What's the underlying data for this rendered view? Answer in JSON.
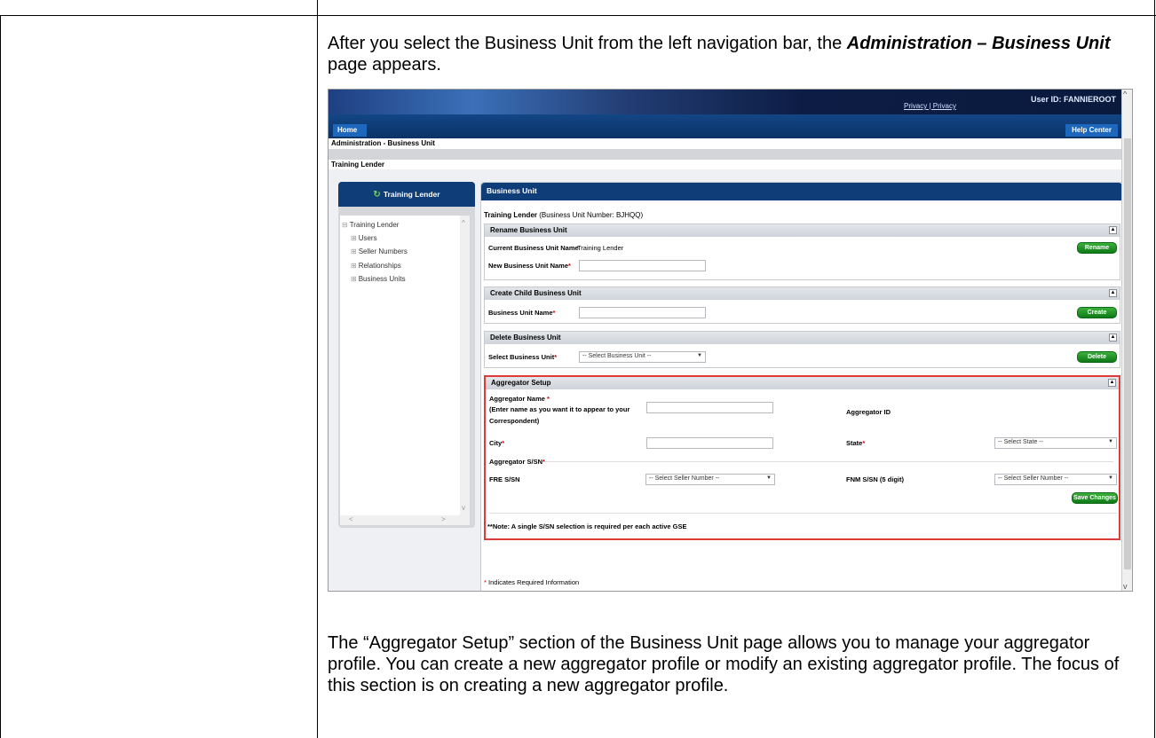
{
  "doc": {
    "intro_pre": "After you select the Business Unit from the left navigation bar, the ",
    "intro_bold": "Administration – Business Unit",
    "intro_post": " page appears.",
    "bottom": "The “Aggregator Setup” section of the Business Unit page allows you to manage your aggregator profile.  You can create a new aggregator profile or modify an existing aggregator profile.  The focus of this section is on creating a new aggregator profile."
  },
  "app": {
    "privacy": "Privacy  |  Privacy",
    "user_id": "User ID: FANNIEROOT",
    "home": "Home",
    "help_center": "Help Center",
    "breadcrumb": "Administration - Business Unit",
    "lender_title": "Training Lender"
  },
  "sidebar": {
    "title": "Training Lender",
    "root": "Training Lender",
    "items": [
      "Users",
      "Seller Numbers",
      "Relationships",
      "Business Units"
    ]
  },
  "business_unit": {
    "title": "Business Unit",
    "lender_name": "Training Lender",
    "lender_number": "(Business Unit Number: BJHQQ)",
    "rename": {
      "title": "Rename Business Unit",
      "current_label": "Current Business Unit Name",
      "current_value": "Training Lender",
      "new_label": "New Business Unit Name",
      "button": "Rename"
    },
    "create": {
      "title": "Create Child Business Unit",
      "name_label": "Business Unit Name",
      "button": "Create"
    },
    "delete": {
      "title": "Delete Business Unit",
      "select_label": "Select Business Unit",
      "select_value": "-- Select Business Unit --",
      "button": "Delete"
    },
    "aggregator": {
      "title": "Aggregator Setup",
      "name_label": "Aggregator Name",
      "name_hint_1": "(Enter name as you want it to appear to your",
      "name_hint_2": "Correspondent)",
      "id_label": "Aggregator ID",
      "city_label": "City",
      "state_label": "State",
      "state_value": "-- Select State --",
      "ssn_label": "Aggregator S/SN",
      "fre_label": "FRE S/SN",
      "fre_value": "-- Select Seller Number --",
      "fnm_label": "FNM S/SN (5 digit)",
      "fnm_value": "-- Select Seller Number --",
      "save_button": "Save Changes",
      "note": "**Note: A single S/SN selection is required per each active GSE"
    },
    "required_note": "Indicates Required Information",
    "required_mark": "*"
  }
}
